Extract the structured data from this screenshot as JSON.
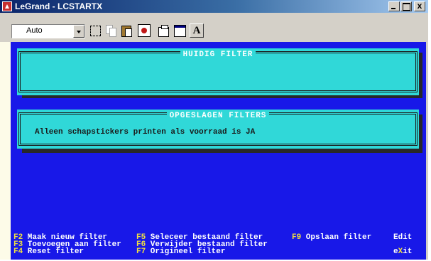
{
  "window": {
    "title": "LeGrand - LCSTARTX",
    "close_glyph": "x"
  },
  "toolbar": {
    "font_select": {
      "value": "Auto"
    },
    "buttons": [
      "select-icon",
      "copy-icon",
      "paste-icon",
      "fullscreen-icon",
      "properties-icon",
      "background-icon",
      "font-icon"
    ],
    "font_button_label": "A"
  },
  "console": {
    "current_filter": {
      "title": "HUIDIG FILTER",
      "content": ""
    },
    "saved_filters": {
      "title": "OPGESLAGEN FILTERS",
      "items": [
        "Alleen schapstickers printen als voorraad is JA"
      ]
    },
    "function_keys": [
      {
        "key": "F2",
        "label": " Maak nieuw filter"
      },
      {
        "key": "F3",
        "label": " Toevoegen aan filter"
      },
      {
        "key": "F4",
        "label": " Reset filter"
      },
      {
        "key": "F5",
        "label": " Seleceer bestaand filter"
      },
      {
        "key": "F6",
        "label": " Verwijder bestaand filter"
      },
      {
        "key": "F7",
        "label": " Origineel filter"
      },
      {
        "key": "F9",
        "label": " Opslaan filter"
      }
    ],
    "edit_label": "Edit",
    "exit_prefix": "e",
    "exit_key": "X",
    "exit_suffix": "it"
  },
  "colors": {
    "console_bg": "#1818e8",
    "box_bg": "#30d8d8",
    "key_color": "#f0e040",
    "label_color": "#ffffff"
  }
}
